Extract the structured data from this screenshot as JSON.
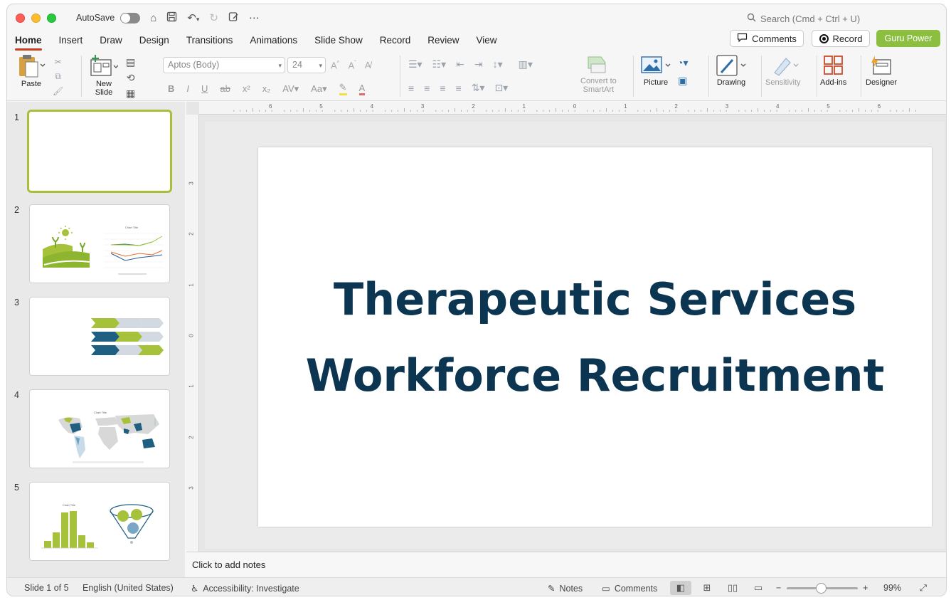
{
  "titlebar": {
    "autosave_label": "AutoSave",
    "search_placeholder": "Search (Cmd + Ctrl + U)"
  },
  "tabs": [
    "Home",
    "Insert",
    "Draw",
    "Design",
    "Transitions",
    "Animations",
    "Slide Show",
    "Record",
    "Review",
    "View"
  ],
  "actions": {
    "comments": "Comments",
    "record": "Record",
    "guru": "Guru Power"
  },
  "ribbon": {
    "paste": "Paste",
    "new_slide_1": "New",
    "new_slide_2": "Slide",
    "font_name": "Aptos (Body)",
    "font_size": "24",
    "convert_1": "Convert to",
    "convert_2": "SmartArt",
    "picture": "Picture",
    "drawing": "Drawing",
    "sensitivity": "Sensitivity",
    "addins": "Add-ins",
    "designer": "Designer"
  },
  "thumbnails": [
    "1",
    "2",
    "3",
    "4",
    "5"
  ],
  "thumb_chart_title": "Chart Title",
  "slide": {
    "title": "Therapeutic Services Workforce Recruitment"
  },
  "notes_placeholder": "Click to add notes",
  "status": {
    "slide_count": "Slide 1 of 5",
    "language": "English (United States)",
    "accessibility": "Accessibility: Investigate",
    "notes": "Notes",
    "comments": "Comments",
    "zoom": "99%"
  },
  "ruler_h_labels": [
    "6",
    "5",
    "4",
    "3",
    "2",
    "1",
    "0",
    "1",
    "2",
    "3",
    "4",
    "5",
    "6"
  ],
  "ruler_v_labels": [
    "3",
    "2",
    "1",
    "0",
    "1",
    "2",
    "3"
  ],
  "colors": {
    "accent_tab": "#c43e1c",
    "guru": "#8cbf3f",
    "title_text": "#0b3551",
    "thumb_green": "#a5c23a",
    "thumb_blue": "#1f5f82"
  }
}
